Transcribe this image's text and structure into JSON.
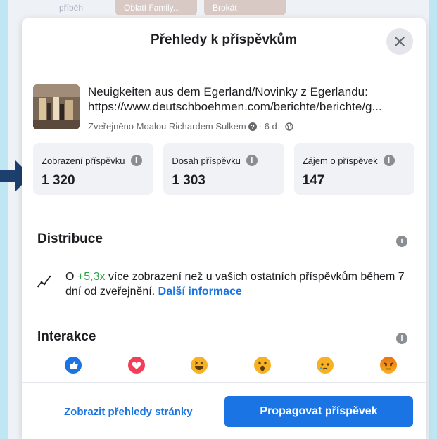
{
  "background": {
    "chips": [
      "příběh",
      "Oblatí Family...",
      "Brokát"
    ]
  },
  "dialog": {
    "title": "Přehledy k příspěvkům",
    "close_icon": "close-icon"
  },
  "post": {
    "title_line1": "Neuigkeiten aus dem Egerland/Novinky z Egerlandu:",
    "title_line2": "https://www.deutschboehmen.com/berichte/berichte/g...",
    "meta_prefix": "Zveřejněno Moalou Richardem Sulkem",
    "meta_age": "· 6 d ·"
  },
  "stats": [
    {
      "label": "Zobrazení příspěvku",
      "value": "1 320"
    },
    {
      "label": "Dosah příspěvku",
      "value": "1 303"
    },
    {
      "label": "Zájem o příspěvek",
      "value": "147"
    }
  ],
  "distribution": {
    "title": "Distribuce",
    "text_prefix": "O",
    "highlight": "+5,3x",
    "text_middle": "více zobrazení než u vašich ostatních příspěvkům během 7 dní od zveřejnění.",
    "link": "Další informace"
  },
  "interactions": {
    "title": "Interakce",
    "reactions": [
      "like-icon",
      "love-icon",
      "haha-icon",
      "wow-icon",
      "sad-icon",
      "angry-icon"
    ]
  },
  "footer": {
    "secondary_label": "Zobrazit přehledy stránky",
    "primary_label": "Propagovat příspěvek"
  },
  "colors": {
    "accent": "#1b74e4",
    "positive": "#31a24c",
    "arrow": "#1d3f6e"
  }
}
